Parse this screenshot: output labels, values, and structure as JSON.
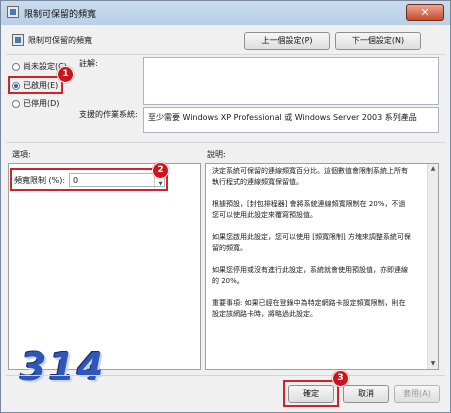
{
  "window": {
    "title": "限制可保留的頻寬",
    "close_glyph": "✕"
  },
  "header": {
    "title": "限制可保留的頻寬",
    "prev_button": "上一個設定(P)",
    "next_button": "下一個設定(N)"
  },
  "state": {
    "options": [
      {
        "label": "尚未設定(C)",
        "selected": false
      },
      {
        "label": "已啟用(E)",
        "selected": true
      },
      {
        "label": "已停用(D)",
        "selected": false
      }
    ]
  },
  "comment": {
    "label": "註解:",
    "value": ""
  },
  "supported": {
    "label": "支援的作業系統:",
    "value": "至少需要 Windows XP Professional 或 Windows Server 2003 系列產品"
  },
  "options_section": {
    "label": "選項:",
    "bandwidth_label": "頻寬限制 (%):",
    "bandwidth_value": "0"
  },
  "help_section": {
    "label": "說明:",
    "paragraphs": [
      "決定系統可保留的連線頻寬百分比。這個數值會限制系統上所有執行程式的連線頻寬保留值。",
      "根據預設，[封包排程器] 會將系統連線頻寬限制在 20%，不過您可以使用此設定來覆寫預設值。",
      "如果您啟用此設定，您可以使用 [頻寬限制] 方塊來調整系統可保留的頻寬。",
      "如果您停用或沒有進行此設定，系統就會使用預設值，亦即連線的 20%。",
      "重要事項: 如果已經在登錄中為特定網路卡設定頻寬限制，則在設定該網路卡時，將略過此設定。"
    ]
  },
  "footer": {
    "ok": "確定",
    "cancel": "取消",
    "apply": "套用(A)"
  },
  "annotations": {
    "badge1": "1",
    "badge2": "2",
    "badge3": "3",
    "watermark": "314"
  },
  "colors": {
    "highlight_red": "#d0232a",
    "badge_red": "#c9161e",
    "watermark_blue": "#2f56b9"
  }
}
